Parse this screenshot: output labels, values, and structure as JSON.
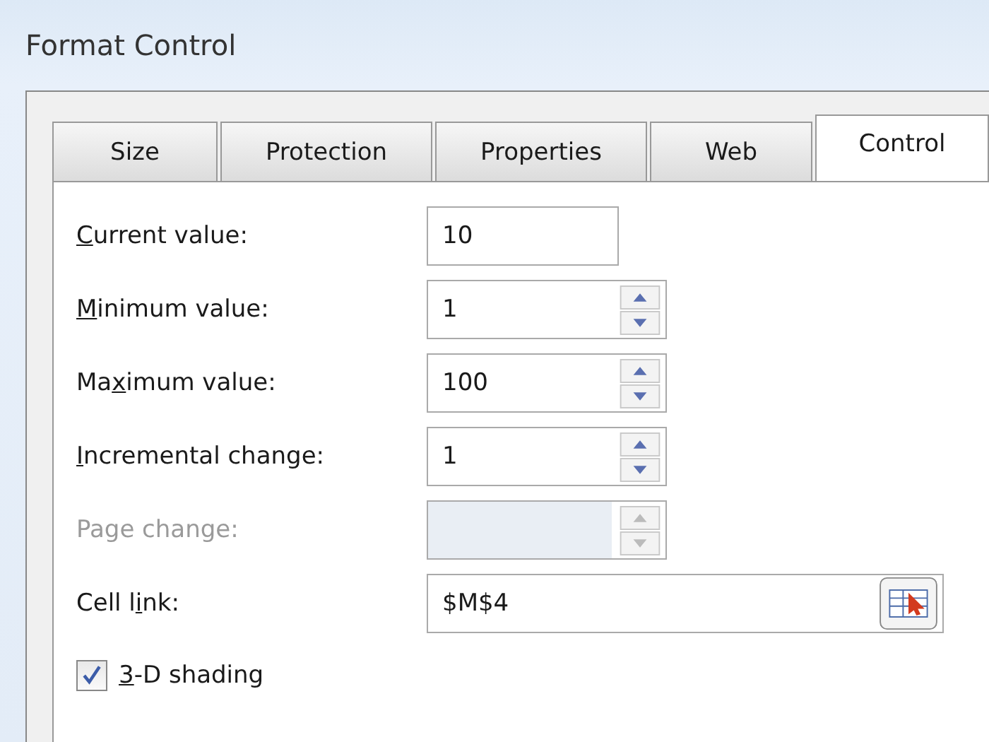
{
  "window": {
    "title": "Format Control"
  },
  "tabs": [
    {
      "label": "Size",
      "selected": false
    },
    {
      "label": "Protection",
      "selected": false
    },
    {
      "label": "Properties",
      "selected": false
    },
    {
      "label": "Web",
      "selected": false
    },
    {
      "label": "Control",
      "selected": true
    }
  ],
  "fields": [
    {
      "kind": "text",
      "label": {
        "key": "C",
        "post": "urrent value:"
      },
      "value": "10",
      "disabled": false
    },
    {
      "kind": "spinner",
      "label": {
        "key": "M",
        "post": "inimum value:"
      },
      "value": "1",
      "disabled": false
    },
    {
      "kind": "spinner",
      "label": {
        "pre": "Ma",
        "key": "x",
        "post": "imum value:"
      },
      "value": "100",
      "disabled": false
    },
    {
      "kind": "spinner",
      "label": {
        "key": "I",
        "post": "ncremental change:"
      },
      "value": "1",
      "disabled": false
    },
    {
      "kind": "spinner",
      "label": {
        "pre": "Page change:"
      },
      "disabled": true
    },
    {
      "kind": "reference",
      "label": {
        "pre": "Cell l",
        "key": "i",
        "post": "nk:"
      },
      "value": "$M$4",
      "disabled": false
    }
  ],
  "shading": {
    "label": {
      "key": "3",
      "post": "-D shading"
    },
    "checked": true
  }
}
